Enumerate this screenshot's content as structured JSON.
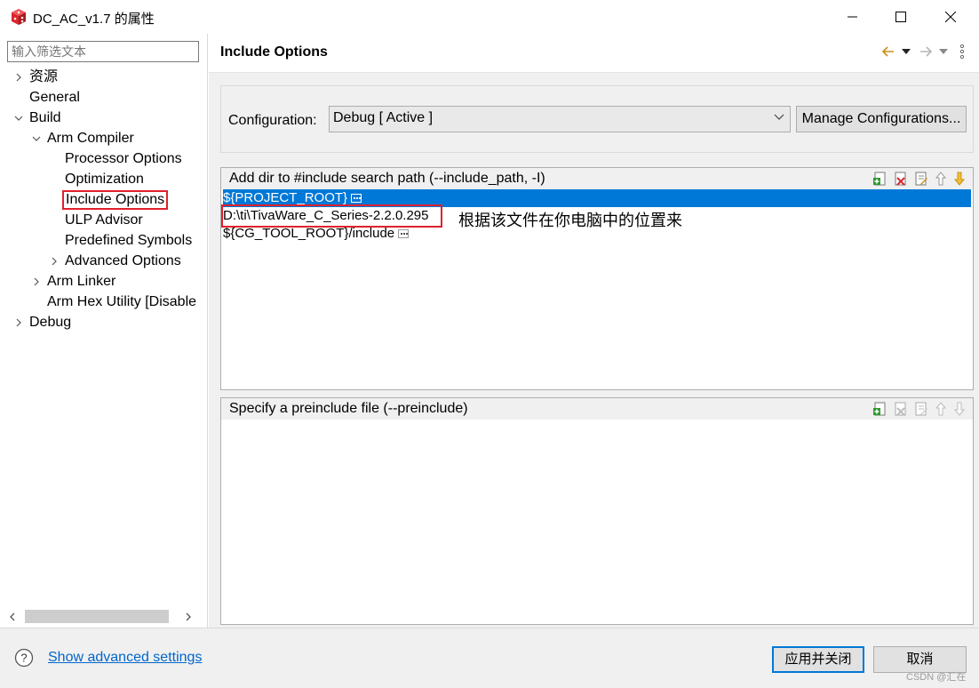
{
  "window": {
    "title": "DC_AC_v1.7 的属性",
    "accent_color": "#0078d7",
    "highlight_color": "#e0202c"
  },
  "filter": {
    "placeholder": "输入筛选文本"
  },
  "tree": {
    "resource": "资源",
    "general": "General",
    "build": "Build",
    "arm_compiler": "Arm Compiler",
    "processor_options": "Processor Options",
    "optimization": "Optimization",
    "include_options": "Include Options",
    "ulp_advisor": "ULP Advisor",
    "predefined_symbols": "Predefined Symbols",
    "advanced_options": "Advanced Options",
    "arm_linker": "Arm Linker",
    "arm_hex_utility": "Arm Hex Utility  [Disable",
    "debug": "Debug"
  },
  "page": {
    "title": "Include Options"
  },
  "config": {
    "label": "Configuration:",
    "selected": "Debug  [ Active ]",
    "manage_button": "Manage Configurations..."
  },
  "include_path": {
    "header": "Add dir to #include search path (--include_path, -I)",
    "items": [
      "${PROJECT_ROOT}",
      "D:\\ti\\TivaWare_C_Series-2.2.0.295",
      "${CG_TOOL_ROOT}/include"
    ],
    "annotation": "根据该文件在你电脑中的位置来"
  },
  "preinclude": {
    "header": "Specify a preinclude file (--preinclude)"
  },
  "footer": {
    "advanced_link": "Show advanced settings",
    "apply_button": "应用并关闭",
    "cancel_button": "取消",
    "watermark": "CSDN @汇在"
  }
}
